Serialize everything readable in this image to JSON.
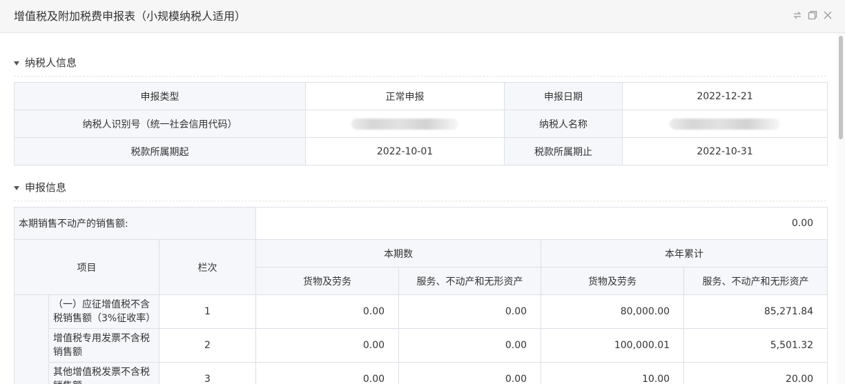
{
  "window": {
    "title": "增值税及附加税费申报表（小规模纳税人适用）",
    "controls": [
      "restore-icon",
      "maximize-icon",
      "close-icon"
    ]
  },
  "taxpayer_section": {
    "title": "纳税人信息",
    "rows": [
      {
        "label1": "申报类型",
        "value1": "正常申报",
        "label2": "申报日期",
        "value2": "2022-12-21"
      },
      {
        "label1": "纳税人识别号（统一社会信用代码）",
        "value1": "",
        "label2": "纳税人名称",
        "value2": ""
      },
      {
        "label1": "税款所属期起",
        "value1": "2022-10-01",
        "label2": "税款所属期止",
        "value2": "2022-10-31"
      }
    ]
  },
  "declaration_section": {
    "title": "申报信息",
    "real_estate_label": "本期销售不动产的销售额:",
    "real_estate_value": "0.00",
    "headers": {
      "project": "项目",
      "column_no": "栏次",
      "current_period": "本期数",
      "year_total": "本年累计",
      "goods_services": "货物及劳务",
      "services_realestate_intangibles": "服务、不动产和无形资产"
    },
    "rows": [
      {
        "name": "（一）应征增值税不含税销售额（3%征收率）",
        "no": "1",
        "cur_goods": "0.00",
        "cur_services": "0.00",
        "year_goods": "80,000.00",
        "year_services": "85,271.84"
      },
      {
        "name": "增值税专用发票不含税销售额",
        "no": "2",
        "cur_goods": "0.00",
        "cur_services": "0.00",
        "year_goods": "100,000.01",
        "year_services": "5,501.32"
      },
      {
        "name": "其他增值税发票不含税销售额",
        "no": "3",
        "cur_goods": "0.00",
        "cur_services": "0.00",
        "year_goods": "10.00",
        "year_services": "20.00"
      }
    ]
  }
}
